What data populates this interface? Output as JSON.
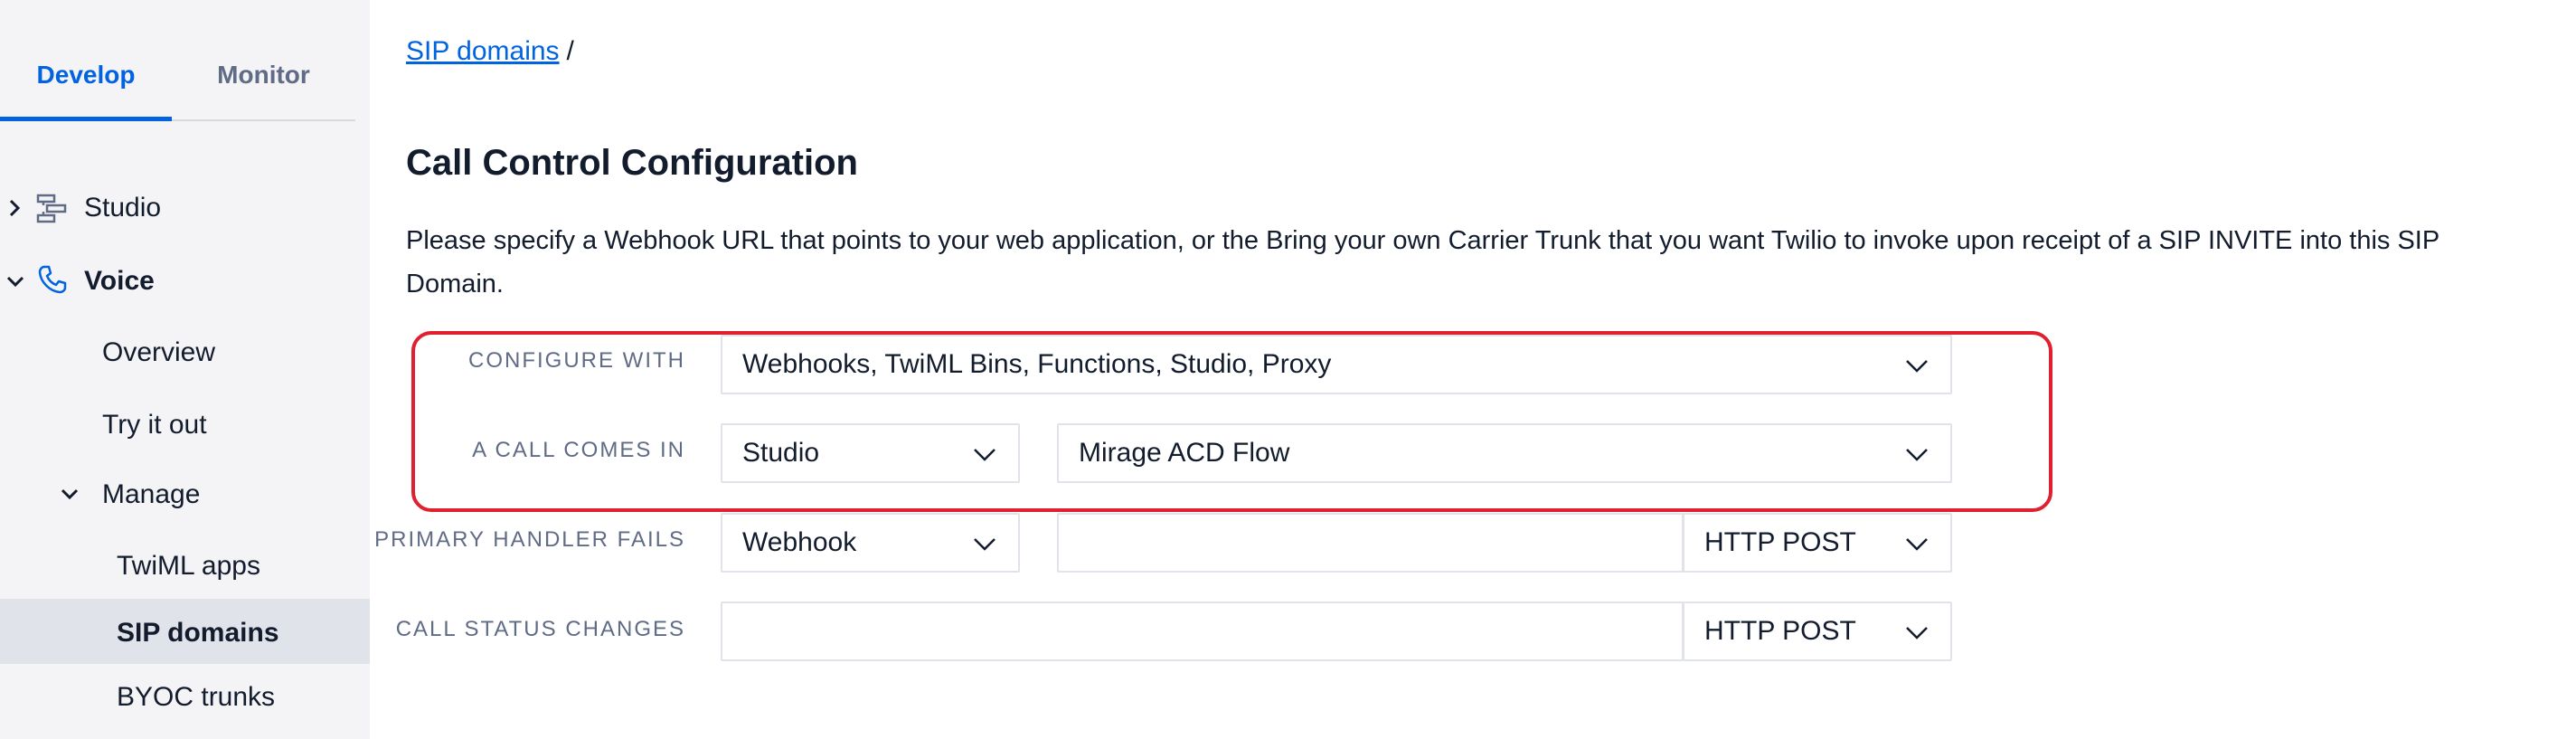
{
  "sidebar": {
    "tabs": [
      {
        "label": "Develop",
        "active": true
      },
      {
        "label": "Monitor",
        "active": false
      }
    ],
    "nav": {
      "studio": {
        "label": "Studio",
        "icon": "studio-flow-icon"
      },
      "voice": {
        "label": "Voice",
        "icon": "phone-icon"
      },
      "overview": {
        "label": "Overview"
      },
      "try_it_out": {
        "label": "Try it out"
      },
      "manage": {
        "label": "Manage"
      },
      "twiml_apps": {
        "label": "TwiML apps"
      },
      "sip_domains": {
        "label": "SIP domains",
        "selected": true
      },
      "byoc_trunks": {
        "label": "BYOC trunks"
      }
    }
  },
  "breadcrumb": {
    "link": "SIP domains",
    "separator": "/"
  },
  "page": {
    "title": "Call Control Configuration",
    "description": "Please specify a Webhook URL that points to your web application, or the Bring your own Carrier Trunk that you want Twilio to invoke upon receipt of a SIP INVITE into this SIP Domain."
  },
  "form": {
    "configure_with": {
      "label": "CONFIGURE WITH",
      "value": "Webhooks, TwiML Bins, Functions, Studio, Proxy"
    },
    "call_comes_in": {
      "label": "A CALL COMES IN",
      "type": "Studio",
      "flow": "Mirage ACD Flow"
    },
    "primary_handler_fails": {
      "label": "PRIMARY HANDLER FAILS",
      "type": "Webhook",
      "url": "",
      "method": "HTTP POST"
    },
    "call_status_changes": {
      "label": "CALL STATUS CHANGES",
      "url": "",
      "method": "HTTP POST"
    }
  },
  "colors": {
    "accent": "#0263e0",
    "highlight": "#e0202e",
    "sidebar_bg": "#f4f4f6",
    "selected_bg": "#e1e3ea"
  }
}
